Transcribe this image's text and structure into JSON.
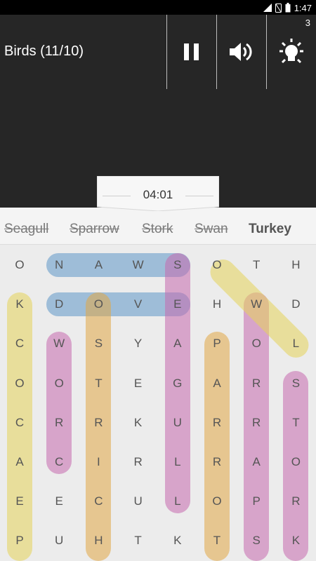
{
  "status": {
    "time": "1:47"
  },
  "toolbar": {
    "title": "Birds (11/10)",
    "hint_count": "3",
    "icons": [
      "pause-icon",
      "volume-icon",
      "lightbulb-icon"
    ]
  },
  "timer": "04:01",
  "words": [
    {
      "text": "Seagull",
      "found": true
    },
    {
      "text": "Sparrow",
      "found": true
    },
    {
      "text": "Stork",
      "found": true
    },
    {
      "text": "Swan",
      "found": true
    },
    {
      "text": "Turkey",
      "found": false
    }
  ],
  "grid": {
    "rows": [
      [
        "O",
        "N",
        "A",
        "W",
        "S",
        "O",
        "T",
        "H"
      ],
      [
        "K",
        "D",
        "O",
        "V",
        "E",
        "H",
        "W",
        "D"
      ],
      [
        "C",
        "W",
        "S",
        "Y",
        "A",
        "P",
        "O",
        "L"
      ],
      [
        "O",
        "O",
        "T",
        "E",
        "G",
        "A",
        "R",
        "S"
      ],
      [
        "C",
        "R",
        "R",
        "K",
        "U",
        "R",
        "R",
        "T"
      ],
      [
        "A",
        "C",
        "I",
        "R",
        "L",
        "R",
        "A",
        "O"
      ],
      [
        "E",
        "E",
        "C",
        "U",
        "L",
        "O",
        "P",
        "R"
      ],
      [
        "P",
        "U",
        "H",
        "T",
        "K",
        "T",
        "S",
        "K"
      ]
    ]
  },
  "highlight_colors": {
    "blue": "#5f98c9",
    "yellow": "#e5d35a",
    "purple": "#c66aaf",
    "orange": "#e2a746"
  }
}
